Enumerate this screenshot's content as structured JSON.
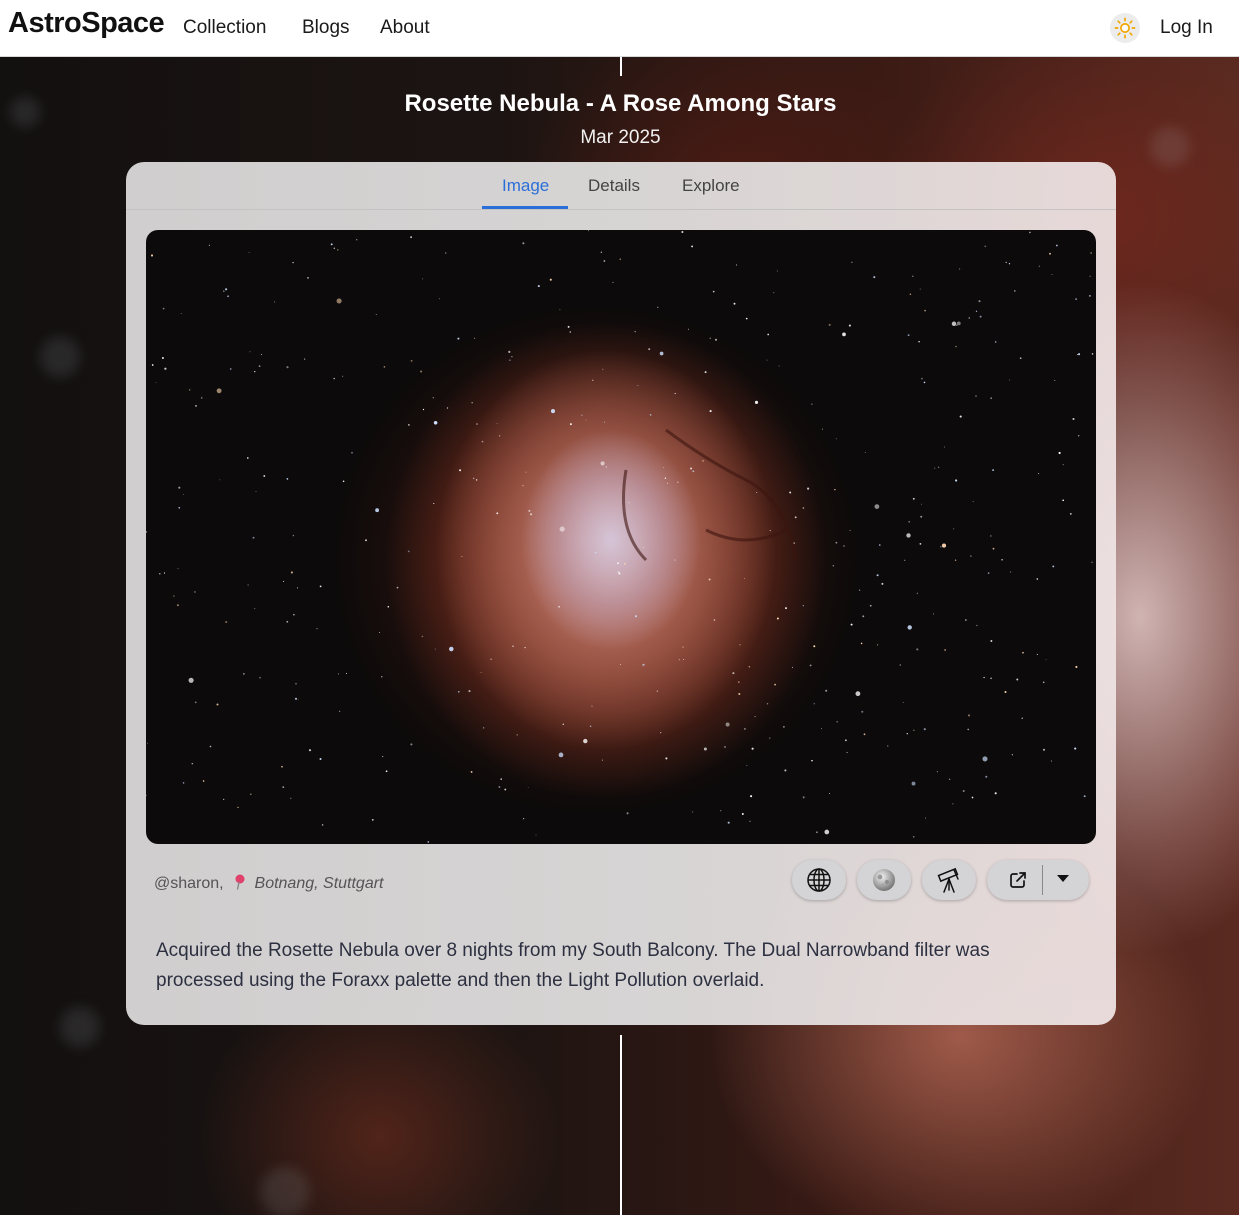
{
  "nav": {
    "brand": "AstroSpace",
    "links": [
      "Collection",
      "Blogs",
      "About"
    ],
    "theme_icon": "sun-icon",
    "login_label": "Log In"
  },
  "post": {
    "title": "Rosette Nebula - A Rose Among Stars",
    "date": "Mar 2025"
  },
  "tabs": {
    "items": [
      "Image",
      "Details",
      "Explore"
    ],
    "active": "Image"
  },
  "image": {
    "subject": "Rosette Nebula astrophotograph"
  },
  "credit": {
    "user": "@sharon,",
    "location_icon": "map-pin-icon",
    "location": "Botnang, Stuttgart"
  },
  "actions": {
    "icons": [
      "globe-icon",
      "moon-icon",
      "telescope-icon",
      "external-link-icon",
      "caret-down-icon"
    ]
  },
  "description": "Acquired the Rosette Nebula over 8 nights from my South Balcony. The Dual Narrowband filter was processed using the Foraxx palette and then the Light Pollution overlaid.",
  "colors": {
    "accent": "#2a6fd8",
    "nebula_red": "#b9503a",
    "nebula_core": "#d6c8dc"
  }
}
